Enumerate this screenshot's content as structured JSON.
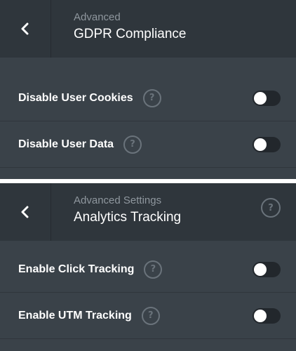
{
  "panels": [
    {
      "sup": "Advanced",
      "title": "GDPR Compliance",
      "rows": [
        {
          "label": "Disable User Cookies",
          "help": "?",
          "enabled": false
        },
        {
          "label": "Disable User Data",
          "help": "?",
          "enabled": false
        }
      ]
    },
    {
      "sup": "Advanced Settings",
      "title": "Analytics Tracking",
      "header_help": "?",
      "rows": [
        {
          "label": "Enable Click Tracking",
          "help": "?",
          "enabled": false
        },
        {
          "label": "Enable UTM Tracking",
          "help": "?",
          "enabled": false
        }
      ]
    }
  ],
  "icons": {
    "back": "chevron-left-icon",
    "help": "question-circle-icon"
  },
  "colors": {
    "panel_bg": "#3a4249",
    "header_bg": "#2f363c",
    "toggle_off": "#22272c",
    "muted_text": "#8f979e"
  }
}
